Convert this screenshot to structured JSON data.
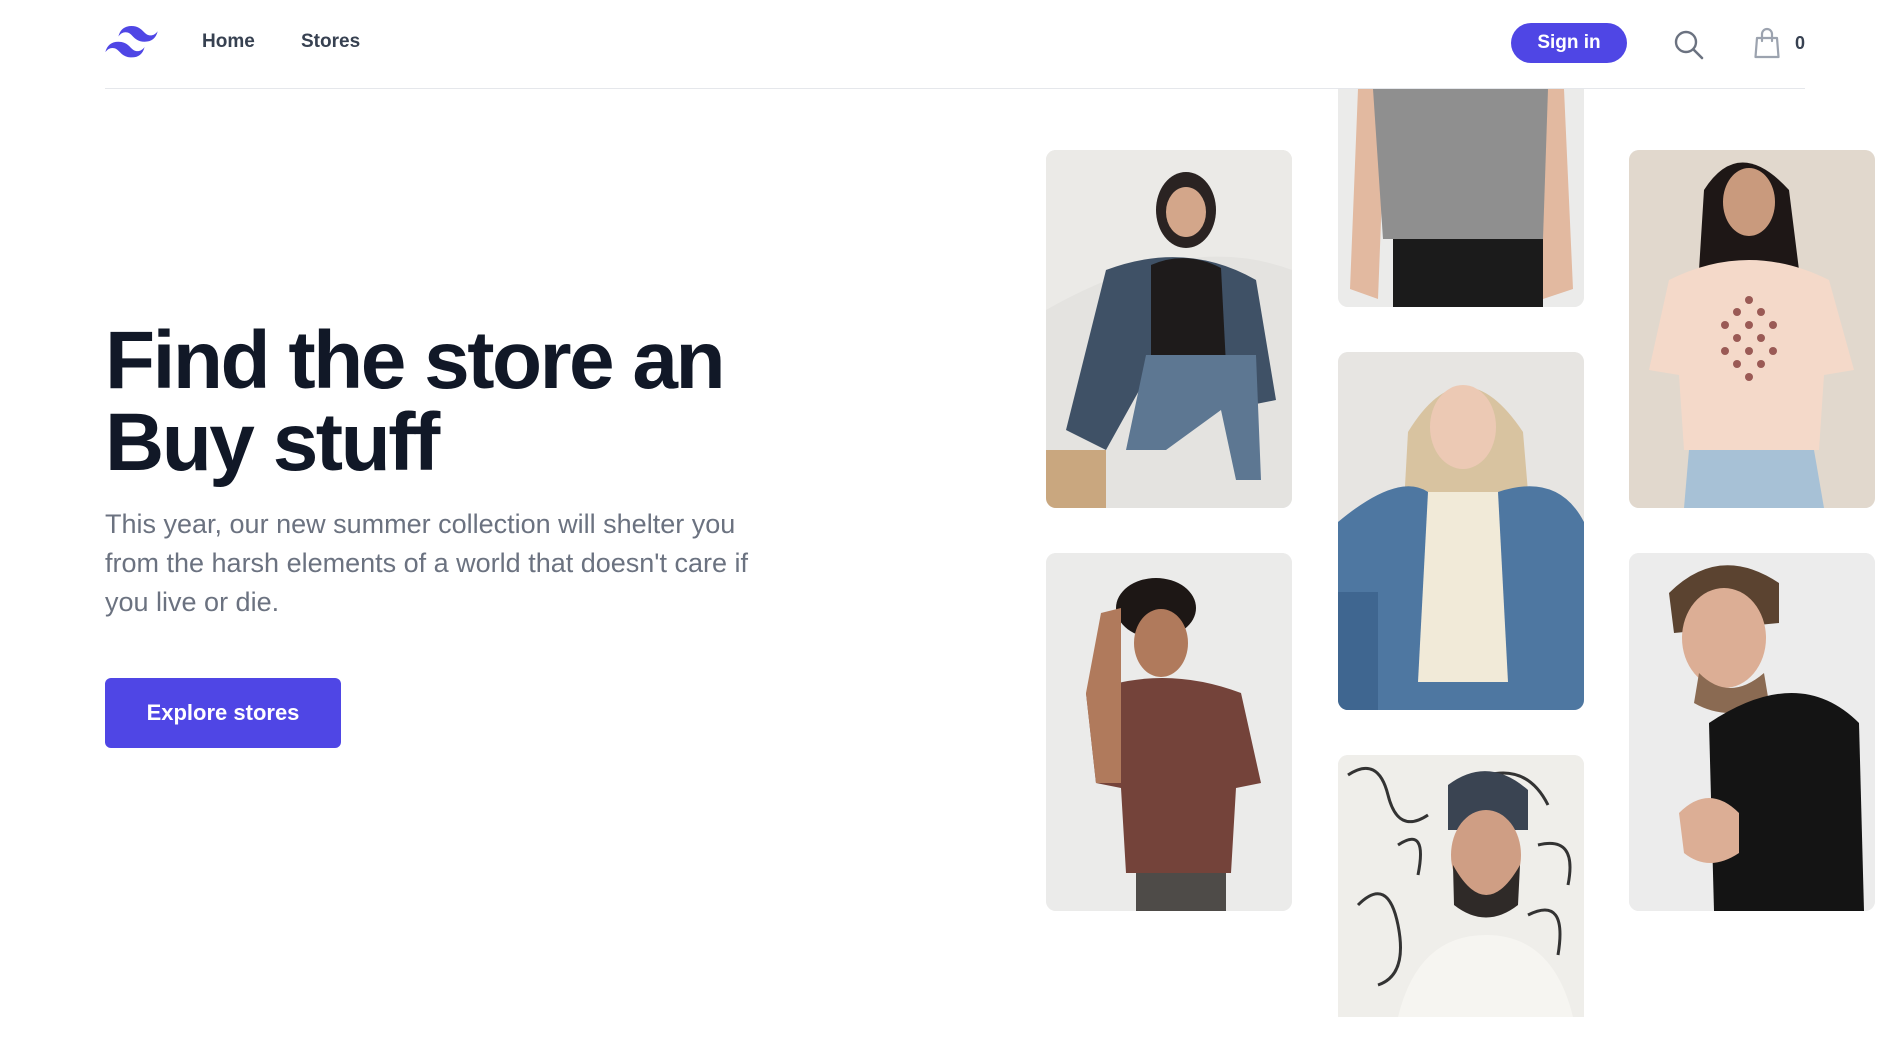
{
  "header": {
    "logo": "tailwind-waves-logo",
    "nav": [
      {
        "label": "Home"
      },
      {
        "label": "Stores"
      }
    ],
    "signin_label": "Sign in",
    "search_icon": "search-icon",
    "cart_icon": "shopping-bag-icon",
    "cart_count": "0"
  },
  "hero": {
    "title_line1": "Find the store an",
    "title_line2": "Buy stuff",
    "description": "This year, our new summer collection will shelter you from the harsh elements of a world that doesn't care if you live or die.",
    "cta_label": "Explore stores"
  },
  "images": [
    {
      "name": "woman-denim-jacket-black-tee-photo"
    },
    {
      "name": "man-gray-tee-photo"
    },
    {
      "name": "blonde-woman-denim-jacket-photo"
    },
    {
      "name": "bearded-man-beanie-photo"
    },
    {
      "name": "woman-pink-graphic-tee-photo"
    },
    {
      "name": "curly-man-brown-tee-photo"
    },
    {
      "name": "man-black-tee-photo"
    }
  ],
  "colors": {
    "accent": "#4f46e5",
    "heading": "#111827",
    "body_text": "#6b7280",
    "nav_text": "#374151",
    "divider": "#e5e7eb"
  }
}
